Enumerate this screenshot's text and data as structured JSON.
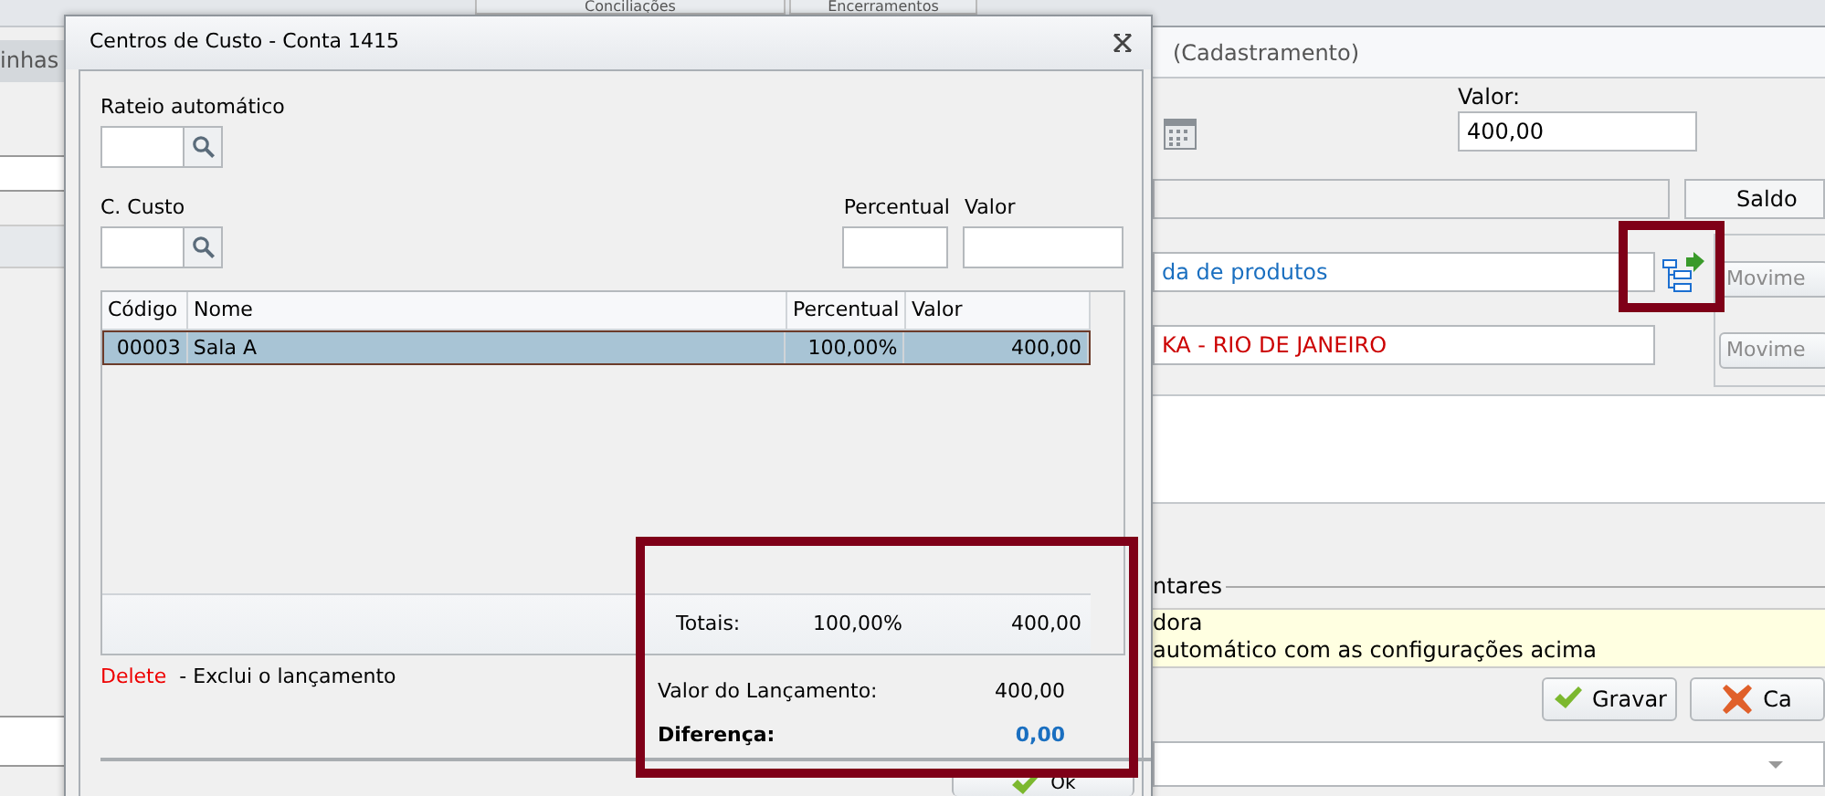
{
  "background_tabs": [
    {
      "label": "Conciliações"
    },
    {
      "label": "Encerramentos"
    }
  ],
  "left_window": {
    "tab": "inhas"
  },
  "dialog": {
    "title": "Centros de Custo - Conta 1415",
    "rateio": {
      "label": "Rateio automático"
    },
    "c_custo": {
      "label": "C. Custo"
    },
    "percentual": {
      "label": "Percentual"
    },
    "valor": {
      "label": "Valor"
    },
    "table": {
      "columns": [
        "Código",
        "Nome",
        "Percentual",
        "Valor"
      ],
      "rows": [
        {
          "cells": [
            "00003",
            "Sala A",
            "100,00%",
            "400,00"
          ],
          "selected": true
        }
      ]
    },
    "totals": {
      "label": "Totais:",
      "percentual": "100,00%",
      "valor": "400,00"
    },
    "hint": {
      "key": "Delete",
      "text": "- Exclui o lançamento"
    },
    "valor_lancamento": {
      "label": "Valor do Lançamento:",
      "value": "400,00"
    },
    "diferenca": {
      "label": "Diferença:",
      "value": "0,00"
    },
    "ok_button": "Ok"
  },
  "right_window": {
    "title": "(Cadastramento)",
    "valor_label": "Valor:",
    "valor": "400,00",
    "saldo_button": "Saldo",
    "conta_field": "da de produtos",
    "filial_field": "KA - RIO DE JANEIRO",
    "movimento_buttons": [
      {
        "label": "Movime",
        "disabled": true
      },
      {
        "label": "Movime",
        "disabled": true
      }
    ],
    "group_label": "ntares",
    "notes": [
      "dora",
      "automático com as configurações acima"
    ],
    "buttons": [
      {
        "label": "Gravar",
        "kind": "save"
      },
      {
        "label": "Ca",
        "kind": "cancel"
      }
    ]
  }
}
